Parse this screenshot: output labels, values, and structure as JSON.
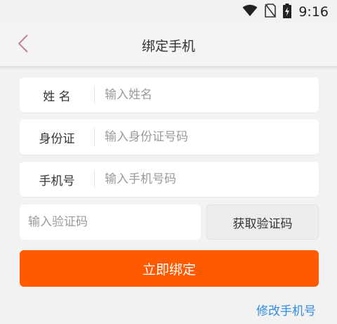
{
  "status_bar": {
    "time": "9:16",
    "icons": [
      "wifi-icon",
      "no-sim-icon",
      "battery-charging-icon"
    ]
  },
  "nav": {
    "title": "绑定手机",
    "back_icon": "chevron-left-icon"
  },
  "form": {
    "name": {
      "label": "姓 名",
      "placeholder": "输入姓名"
    },
    "id_card": {
      "label": "身份证",
      "placeholder": "输入身份证号码"
    },
    "phone": {
      "label": "手机号",
      "placeholder": "输入手机号码"
    },
    "code": {
      "placeholder": "输入验证码"
    },
    "get_code_label": "获取验证码"
  },
  "submit_label": "立即绑定",
  "change_phone_link": "修改手机号",
  "colors": {
    "accent": "#ff5a00",
    "link": "#2f8de4",
    "back_icon": "#c0858a"
  }
}
